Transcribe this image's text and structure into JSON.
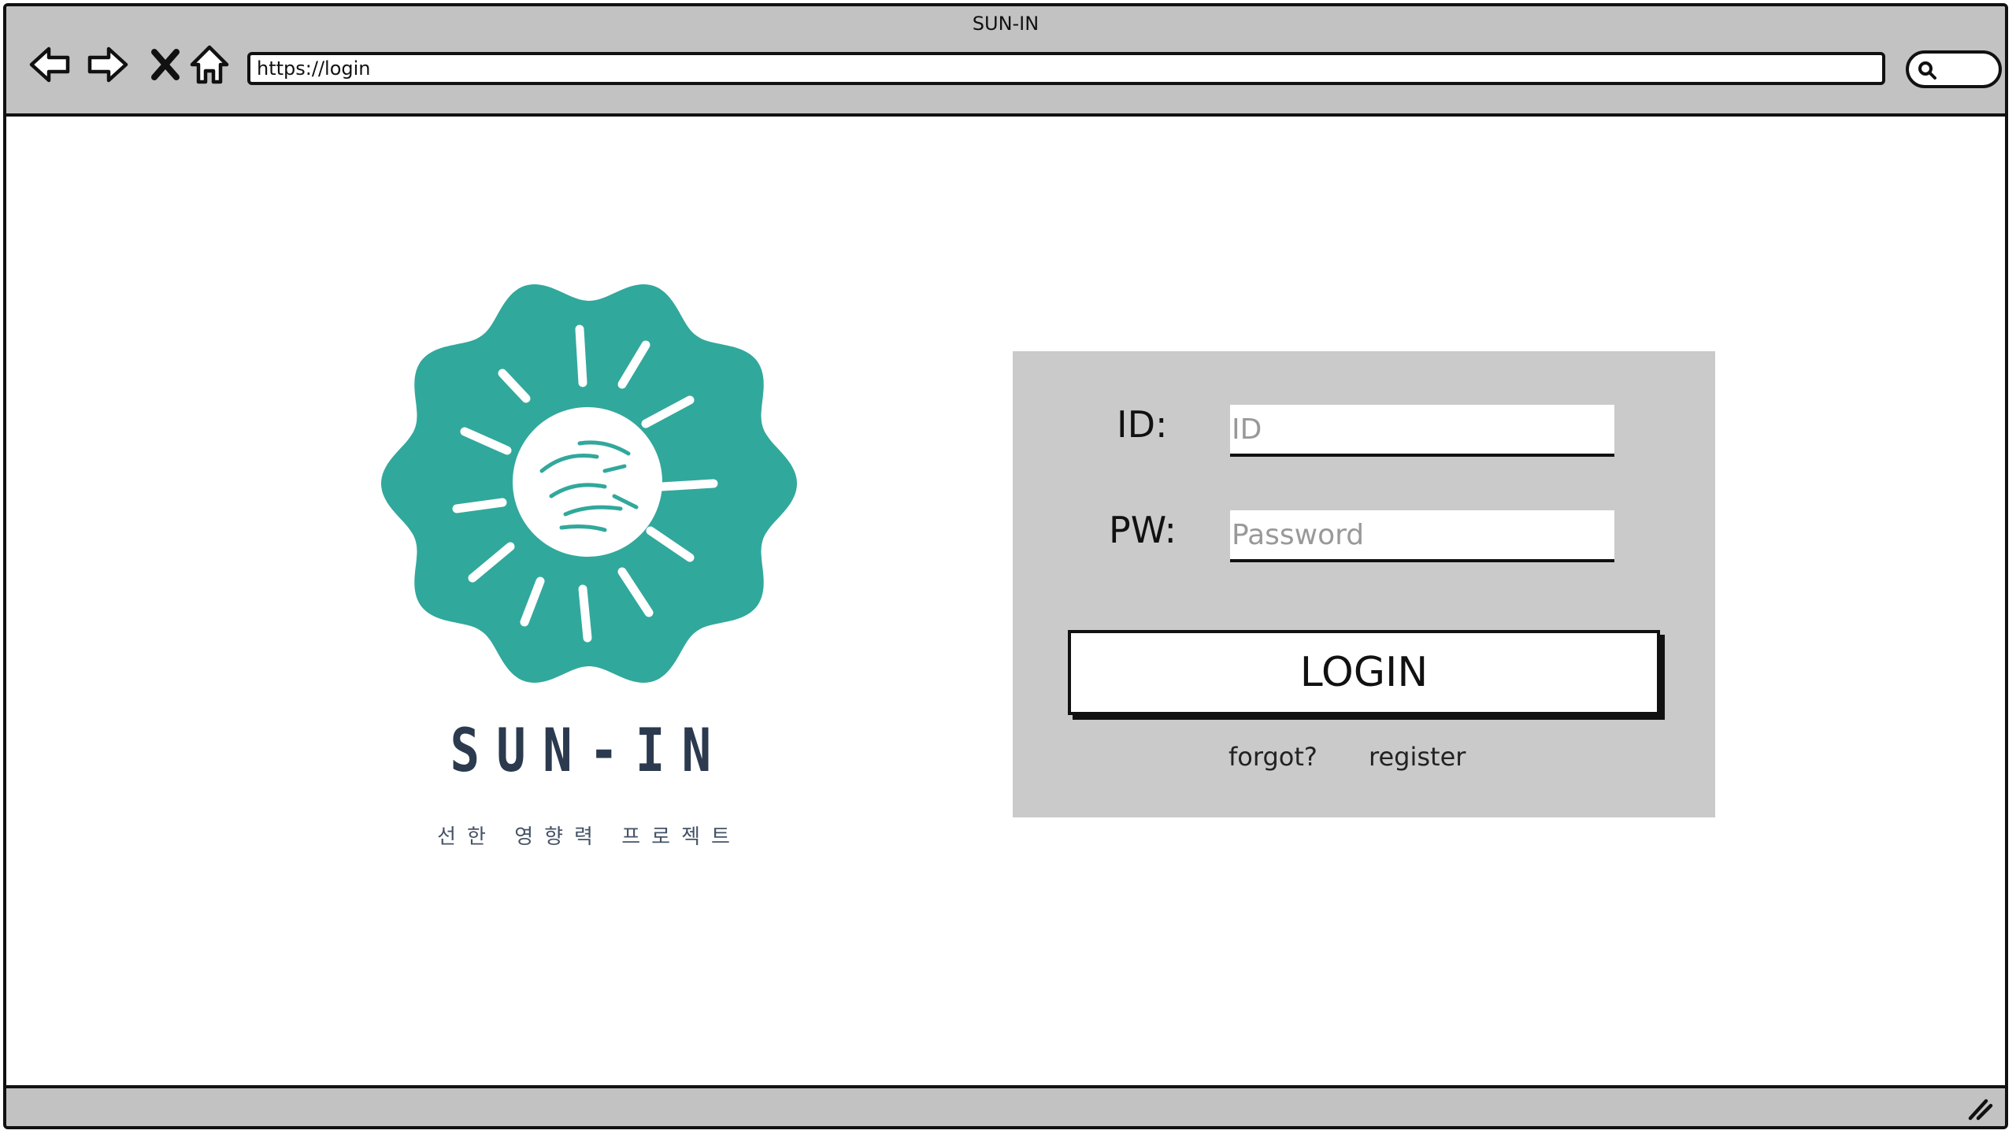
{
  "window": {
    "title": "SUN-IN"
  },
  "toolbar": {
    "url": "https://login",
    "icons": [
      "back-arrow-icon",
      "forward-arrow-icon",
      "close-x-icon",
      "home-icon",
      "search-icon"
    ]
  },
  "brand": {
    "name": "SUN-IN",
    "subtitle": "선한 영향력 프로젝트",
    "logo_color": "#31a89c",
    "text_color": "#2b3a4e"
  },
  "login": {
    "id_label": "ID:",
    "id_placeholder": "ID",
    "pw_label": "PW:",
    "pw_placeholder": "Password",
    "login_button": "LOGIN",
    "forgot_link": "forgot?",
    "register_link": "register",
    "panel_color": "#cacaca"
  }
}
